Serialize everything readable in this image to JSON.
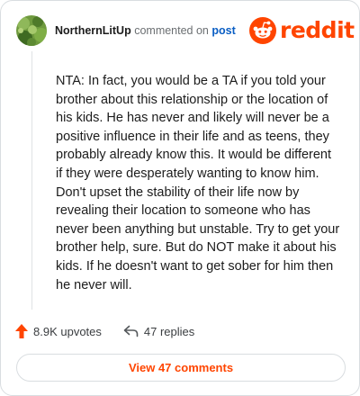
{
  "header": {
    "username": "NorthernLitUp",
    "action_text": "commented on",
    "post_link": "post",
    "logo_text": "reddit"
  },
  "comment": {
    "body": "NTA: In fact, you would be a TA if you told your brother about this relationship or the location of his kids. He has never and likely will never be a positive influence in their life and as teens, they probably already know this. It would be different if they were desperately wanting to know him. Don't upset the stability of their life now by revealing their location to someone who has never been anything but unstable. Try to get your brother help, sure. But do NOT make it about his kids. If he doesn't want to get sober for him then he never will."
  },
  "stats": {
    "upvotes": "8.9K upvotes",
    "replies": "47 replies"
  },
  "footer": {
    "view_comments": "View 47 comments"
  },
  "colors": {
    "brand": "#ff4500",
    "link": "#0a5ec4"
  },
  "icons": {
    "avatar": "avatar-image",
    "logo": "reddit-snoo-icon",
    "upvote": "upvote-arrow-icon",
    "reply": "reply-arrow-icon"
  }
}
